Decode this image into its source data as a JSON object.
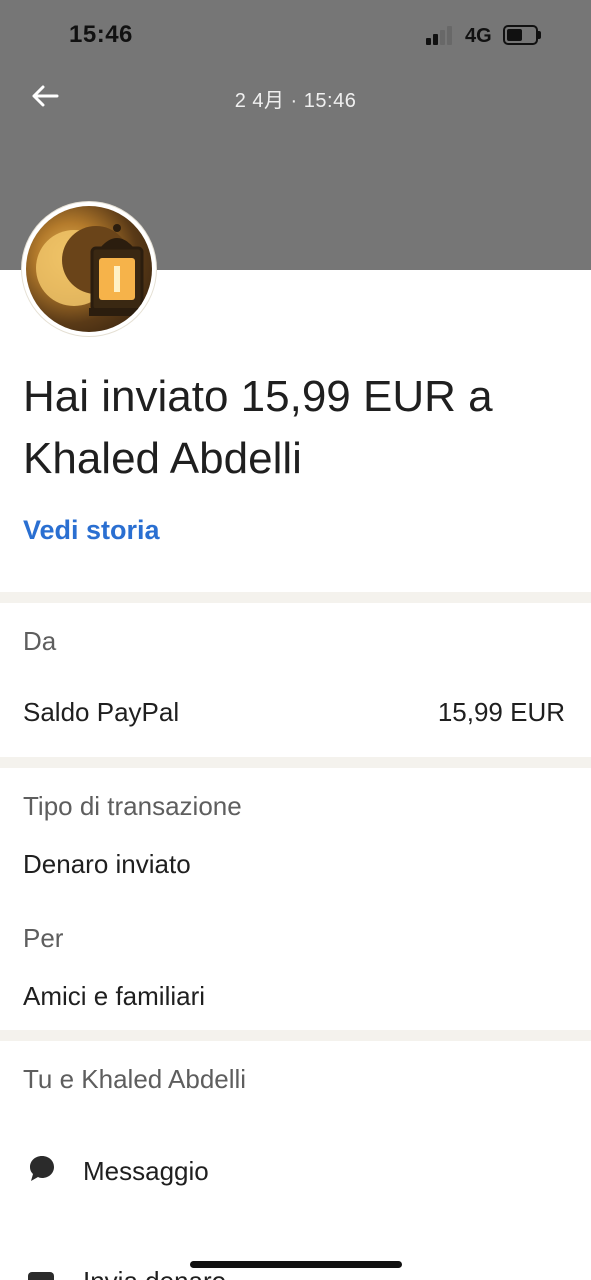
{
  "status_bar": {
    "time": "15:46",
    "network": "4G",
    "battery_level": 0.55
  },
  "header": {
    "date": "2 4月 · 15:46",
    "back_icon": "arrow-left-icon"
  },
  "colors": {
    "header_bg": "#767676",
    "link": "#2a6fd1",
    "divider": "#f4f2ed"
  },
  "transaction": {
    "title": "Hai inviato 15,99 EUR a Khaled Abdelli",
    "history_link": "Vedi storia"
  },
  "from_section": {
    "label": "Da",
    "source": "Saldo PayPal",
    "amount": "15,99 EUR"
  },
  "details": {
    "type_label": "Tipo di transazione",
    "type_value": "Denaro inviato",
    "for_label": "Per",
    "for_value": "Amici e familiari"
  },
  "contact": {
    "header": "Tu e Khaled Abdelli",
    "message_label": "Messaggio",
    "message_icon": "chat-bubble-icon",
    "send_label": "Invia denaro",
    "send_icon": "send-money-icon"
  }
}
